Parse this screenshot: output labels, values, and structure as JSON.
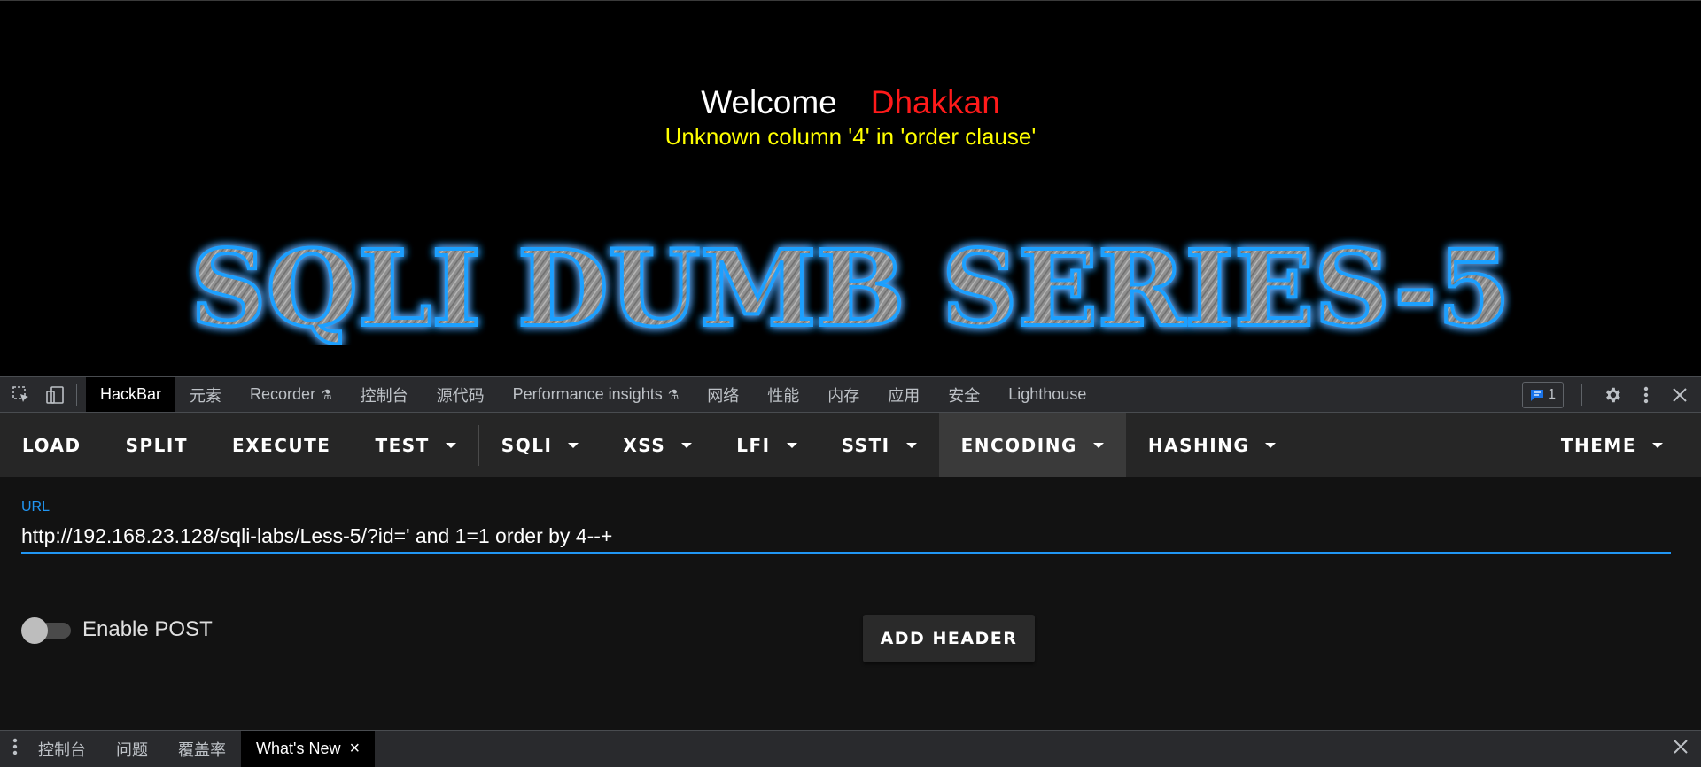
{
  "page": {
    "welcome": "Welcome",
    "username": "Dhakkan",
    "error": "Unknown column '4' in 'order clause'",
    "banner": "SQLI DUMB SERIES-5"
  },
  "devtools": {
    "tabs": [
      {
        "label": "HackBar",
        "active": true
      },
      {
        "label": "元素"
      },
      {
        "label": "Recorder",
        "experimental": true
      },
      {
        "label": "控制台"
      },
      {
        "label": "源代码"
      },
      {
        "label": "Performance insights",
        "experimental": true
      },
      {
        "label": "网络"
      },
      {
        "label": "性能"
      },
      {
        "label": "内存"
      },
      {
        "label": "应用"
      },
      {
        "label": "安全"
      },
      {
        "label": "Lighthouse"
      }
    ],
    "message_count": "1"
  },
  "hackbar": {
    "toolbar": {
      "load": "LOAD",
      "split": "SPLIT",
      "execute": "EXECUTE",
      "test": "TEST",
      "sqli": "SQLI",
      "xss": "XSS",
      "lfi": "LFI",
      "ssti": "SSTI",
      "encoding": "ENCODING",
      "hashing": "HASHING",
      "theme": "THEME"
    },
    "url_label": "URL",
    "url_value": "http://192.168.23.128/sqli-labs/Less-5/?id=' and 1=1 order by 4--+",
    "enable_post": "Enable POST",
    "enable_post_on": false,
    "add_header": "ADD HEADER"
  },
  "drawer": {
    "tabs": [
      {
        "label": "控制台"
      },
      {
        "label": "问题"
      },
      {
        "label": "覆盖率"
      },
      {
        "label": "What's New",
        "active": true
      }
    ]
  },
  "colors": {
    "accent": "#2196f3",
    "username": "#ff1a1a",
    "error": "#ffff00",
    "banner_glow": "#1ea0ff"
  }
}
